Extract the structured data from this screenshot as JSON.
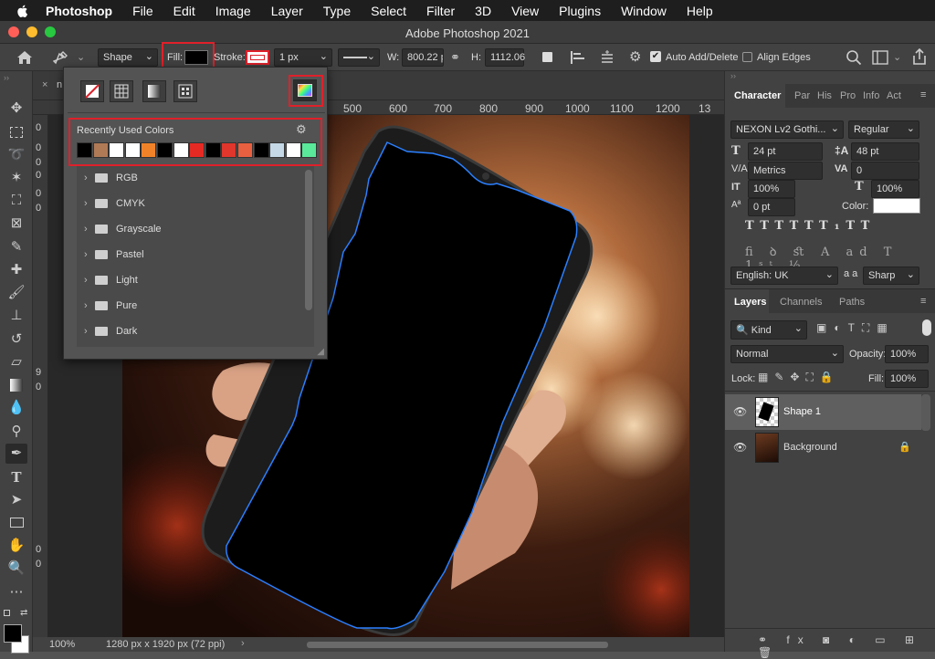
{
  "menubar": {
    "app": "Photoshop",
    "items": [
      "File",
      "Edit",
      "Image",
      "Layer",
      "Type",
      "Select",
      "Filter",
      "3D",
      "View",
      "Plugins",
      "Window",
      "Help"
    ]
  },
  "window": {
    "title": "Adobe Photoshop 2021",
    "doc_tab_prefix": "n"
  },
  "options": {
    "shape_mode": "Shape",
    "fill_label": "Fill:",
    "stroke_label": "Stroke:",
    "stroke_width": "1 px",
    "w_label": "W:",
    "w_value": "800.22 p",
    "h_label": "H:",
    "h_value": "1112.06",
    "auto_add_delete": "Auto Add/Delete",
    "align_edges": "Align Edges"
  },
  "ruler": [
    "500",
    "600",
    "700",
    "800",
    "900",
    "1000",
    "1100",
    "1200",
    "13"
  ],
  "vruler": [
    "0",
    "0",
    "0",
    "0",
    "0",
    "0",
    "0",
    "9",
    "0",
    "0",
    "0"
  ],
  "popup": {
    "recent_label": "Recently Used Colors",
    "recent_colors": [
      "#000000",
      "#b07a56",
      "#ffffff",
      "#ffffff",
      "#f0832a",
      "#000000",
      "#ffffff",
      "#e52a24",
      "#000000",
      "#e0362c",
      "#e86040",
      "#000000",
      "#c4d8e6",
      "#ffffff",
      "#5ae89a"
    ],
    "folders": [
      "RGB",
      "CMYK",
      "Grayscale",
      "Pastel",
      "Light",
      "Pure",
      "Dark"
    ]
  },
  "character": {
    "tabs": [
      "Character",
      "Par",
      "His",
      "Pro",
      "Info",
      "Act"
    ],
    "font_family": "NEXON Lv2 Gothi...",
    "font_style": "Regular",
    "size": "24 pt",
    "leading": "48 pt",
    "kerning": "Metrics",
    "tracking": "0",
    "vscale": "100%",
    "hscale": "100%",
    "baseline": "0 pt",
    "color_label": "Color:",
    "language": "English: UK",
    "aa_label": "a a",
    "aa": "Sharp"
  },
  "layers": {
    "tabs": [
      "Layers",
      "Channels",
      "Paths"
    ],
    "kind": "Kind",
    "blend": "Normal",
    "opacity_label": "Opacity:",
    "opacity": "100%",
    "lock_label": "Lock:",
    "fill_label": "Fill:",
    "fill": "100%",
    "items": [
      {
        "name": "Shape 1"
      },
      {
        "name": "Background"
      }
    ]
  },
  "status": {
    "zoom": "100%",
    "dims": "1280 px x 1920 px (72 ppi)"
  },
  "colors": {
    "highlight": "#e0202a",
    "path": "#2a7fff",
    "accent": "#1473e6"
  }
}
